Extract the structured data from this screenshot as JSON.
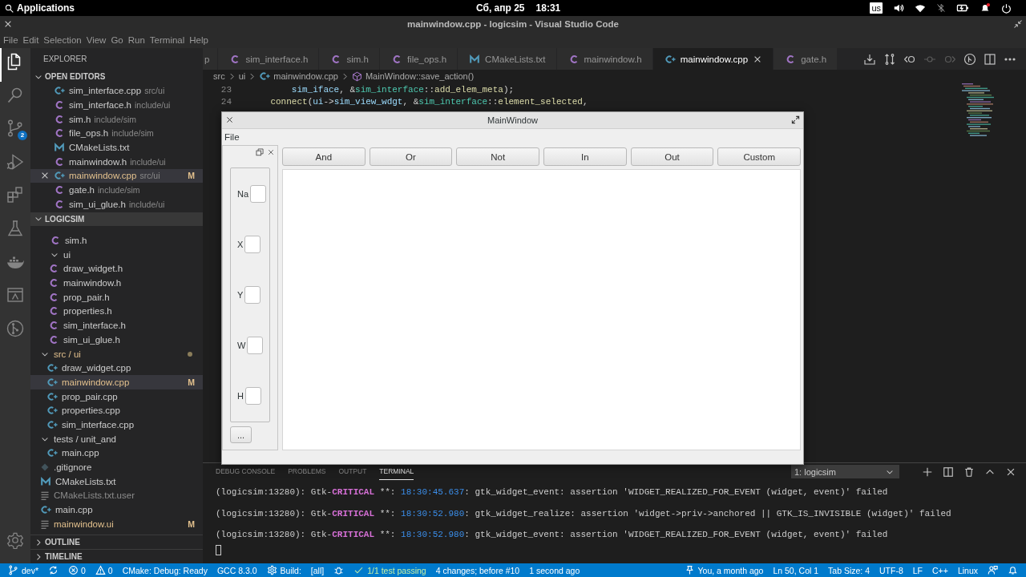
{
  "top_bar": {
    "apps_label": "Applications",
    "date": "Сб, апр 25",
    "time": "18:31",
    "keyboard_layout": "us"
  },
  "window": {
    "title": "mainwindow.cpp - logicsim - Visual Studio Code"
  },
  "menu": [
    "File",
    "Edit",
    "Selection",
    "View",
    "Go",
    "Run",
    "Terminal",
    "Help"
  ],
  "activity_bar": [
    {
      "kind": "explorer",
      "selected": true
    },
    {
      "kind": "search",
      "selected": false
    },
    {
      "kind": "scm",
      "selected": false,
      "badge": "2"
    },
    {
      "kind": "debug",
      "selected": false
    },
    {
      "kind": "extensions",
      "selected": false
    },
    {
      "kind": "testing",
      "selected": false
    },
    {
      "kind": "docker",
      "selected": false
    },
    {
      "kind": "remote",
      "selected": false
    },
    {
      "kind": "git_graph",
      "selected": false
    }
  ],
  "sidebar": {
    "title": "EXPLORER",
    "open_editors": {
      "title": "OPEN EDITORS",
      "expanded": true,
      "items": [
        {
          "name": "sim_interface.cpp",
          "path": "src/ui",
          "kind": "cpp",
          "selected": false,
          "modified": false
        },
        {
          "name": "sim_interface.h",
          "path": "include/ui",
          "kind": "c",
          "selected": false,
          "modified": false
        },
        {
          "name": "sim.h",
          "path": "include/sim",
          "kind": "c",
          "selected": false,
          "modified": false
        },
        {
          "name": "file_ops.h",
          "path": "include/sim",
          "kind": "c",
          "selected": false,
          "modified": false
        },
        {
          "name": "CMakeLists.txt",
          "kind": "cmake",
          "selected": false,
          "modified": false
        },
        {
          "name": "mainwindow.h",
          "path": "include/ui",
          "kind": "c",
          "selected": false,
          "modified": false
        },
        {
          "name": "mainwindow.cpp",
          "path": "src/ui",
          "kind": "cpp",
          "selected": true,
          "modified": true,
          "status": "M"
        },
        {
          "name": "gate.h",
          "path": "include/sim",
          "kind": "c",
          "selected": false,
          "modified": false
        },
        {
          "name": "sim_ui_glue.h",
          "path": "include/ui",
          "kind": "c",
          "selected": false,
          "modified": false
        }
      ]
    },
    "project": {
      "title": "LOGICSIM",
      "expanded": true,
      "scrolled_group": [
        {
          "name": "sim.h",
          "kind": "c",
          "selected": false,
          "modified": false,
          "ignored": false
        },
        {
          "name": "ui",
          "kind": "folder",
          "expanded": true,
          "selected": false,
          "modified": false,
          "ignored": false,
          "children": [
            {
              "name": "draw_widget.h",
              "kind": "c",
              "selected": false,
              "modified": false,
              "ignored": false
            },
            {
              "name": "mainwindow.h",
              "kind": "c",
              "selected": false,
              "modified": false,
              "ignored": false
            },
            {
              "name": "prop_pair.h",
              "kind": "c",
              "selected": false,
              "modified": false,
              "ignored": false
            },
            {
              "name": "properties.h",
              "kind": "c",
              "selected": false,
              "modified": false,
              "ignored": false
            },
            {
              "name": "sim_interface.h",
              "kind": "c",
              "selected": false,
              "modified": false,
              "ignored": false
            },
            {
              "name": "sim_ui_glue.h",
              "kind": "c",
              "selected": false,
              "modified": false,
              "ignored": false
            }
          ]
        }
      ],
      "items": [
        {
          "name": "src / ui",
          "kind": "folder",
          "expanded": true,
          "selected": false,
          "modified": true,
          "ignored": false,
          "children": [
            {
              "name": "draw_widget.cpp",
              "kind": "cpp",
              "selected": false,
              "modified": false,
              "ignored": false
            },
            {
              "name": "mainwindow.cpp",
              "kind": "cpp",
              "selected": true,
              "modified": true,
              "ignored": false,
              "status": "M"
            },
            {
              "name": "prop_pair.cpp",
              "kind": "cpp",
              "selected": false,
              "modified": false,
              "ignored": false
            },
            {
              "name": "properties.cpp",
              "kind": "cpp",
              "selected": false,
              "modified": false,
              "ignored": false
            },
            {
              "name": "sim_interface.cpp",
              "kind": "cpp",
              "selected": false,
              "modified": false,
              "ignored": false
            }
          ]
        },
        {
          "name": "tests / unit_and",
          "kind": "folder",
          "expanded": true,
          "selected": false,
          "modified": false,
          "ignored": false,
          "children": [
            {
              "name": "main.cpp",
              "kind": "cpp",
              "selected": false,
              "modified": false,
              "ignored": false
            }
          ]
        },
        {
          "name": ".gitignore",
          "kind": "git",
          "selected": false,
          "modified": false,
          "ignored": false
        },
        {
          "name": "CMakeLists.txt",
          "kind": "cmake",
          "selected": false,
          "modified": false,
          "ignored": false
        },
        {
          "name": "CMakeLists.txt.user",
          "kind": "text",
          "selected": false,
          "modified": false,
          "ignored": true
        },
        {
          "name": "main.cpp",
          "kind": "cpp",
          "selected": false,
          "modified": false,
          "ignored": false
        },
        {
          "name": "mainwindow.ui",
          "kind": "text",
          "selected": false,
          "modified": true,
          "ignored": false,
          "status": "M"
        }
      ]
    },
    "outline": {
      "title": "OUTLINE",
      "expanded": false
    },
    "timeline": {
      "title": "TIMELINE",
      "expanded": false
    }
  },
  "editor": {
    "tabs": [
      {
        "label": "p",
        "selected": false
      },
      {
        "label": "sim_interface.h",
        "kind": "c",
        "selected": false
      },
      {
        "label": "sim.h",
        "kind": "c",
        "selected": false
      },
      {
        "label": "file_ops.h",
        "kind": "c",
        "selected": false
      },
      {
        "label": "CMakeLists.txt",
        "kind": "cmake",
        "selected": false
      },
      {
        "label": "mainwindow.h",
        "kind": "c",
        "selected": false
      },
      {
        "label": "mainwindow.cpp",
        "kind": "cpp",
        "selected": true
      },
      {
        "label": "gate.h",
        "kind": "c",
        "selected": false
      }
    ],
    "toolbar": [
      {
        "kind": "download",
        "disabled": false
      },
      {
        "kind": "swap",
        "disabled": false
      },
      {
        "kind": "back",
        "disabled": false
      },
      {
        "kind": "commit",
        "disabled": true
      },
      {
        "kind": "forward",
        "disabled": true
      },
      {
        "kind": "graph",
        "disabled": false
      },
      {
        "kind": "split",
        "disabled": false
      },
      {
        "kind": "more",
        "disabled": false
      }
    ],
    "breadcrumb": [
      {
        "label": "src",
        "kind": "folder"
      },
      {
        "label": "ui",
        "kind": "folder"
      },
      {
        "label": "mainwindow.cpp",
        "kind": "cpp"
      },
      {
        "label": "MainWindow::save_action()",
        "kind": "method"
      }
    ],
    "code": [
      {
        "number": "23",
        "tokens": [
          {
            "kind": "var",
            "text": "        sim_iface"
          },
          {
            "kind": "plain",
            "text": ", &"
          },
          {
            "kind": "type",
            "text": "sim_interface"
          },
          {
            "kind": "plain",
            "text": "::"
          },
          {
            "kind": "fn",
            "text": "add_elem_meta"
          },
          {
            "kind": "plain",
            "text": ");"
          }
        ]
      },
      {
        "number": "24",
        "tokens": [
          {
            "kind": "fn",
            "text": "    connect"
          },
          {
            "kind": "plain",
            "text": "("
          },
          {
            "kind": "var",
            "text": "ui"
          },
          {
            "kind": "plain",
            "text": "->"
          },
          {
            "kind": "var",
            "text": "sim_view_wdgt"
          },
          {
            "kind": "plain",
            "text": ", &"
          },
          {
            "kind": "type",
            "text": "sim_interface"
          },
          {
            "kind": "plain",
            "text": "::"
          },
          {
            "kind": "fn",
            "text": "element_selected"
          },
          {
            "kind": "plain",
            "text": ","
          }
        ]
      }
    ]
  },
  "qt_window": {
    "title": "MainWindow",
    "menu": [
      "File"
    ],
    "dock": {
      "fields": [
        {
          "label": "Na"
        },
        {
          "label": "X"
        },
        {
          "label": "Y"
        },
        {
          "label": "W"
        },
        {
          "label": "H"
        }
      ],
      "more_button": "..."
    },
    "buttons": [
      "And",
      "Or",
      "Not",
      "In",
      "Out",
      "Custom"
    ]
  },
  "panel": {
    "tabs": [
      {
        "label": "DEBUG CONSOLE",
        "selected": false
      },
      {
        "label": "PROBLEMS",
        "selected": false
      },
      {
        "label": "OUTPUT",
        "selected": false
      },
      {
        "label": "TERMINAL",
        "selected": true
      }
    ],
    "terminal_select": "1: logicsim",
    "lines": [
      [
        {
          "kind": "plain",
          "text": "(logicsim:13280): Gtk-"
        },
        {
          "kind": "critical",
          "text": "CRITICAL"
        },
        {
          "kind": "plain",
          "text": " **: "
        },
        {
          "kind": "time",
          "text": "18:30:45.637"
        },
        {
          "kind": "plain",
          "text": ": gtk_widget_event: assertion 'WIDGET_REALIZED_FOR_EVENT (widget, event)' failed"
        }
      ],
      [
        {
          "kind": "plain",
          "text": "(logicsim:13280): Gtk-"
        },
        {
          "kind": "critical",
          "text": "CRITICAL"
        },
        {
          "kind": "plain",
          "text": " **: "
        },
        {
          "kind": "time",
          "text": "18:30:52.980"
        },
        {
          "kind": "plain",
          "text": ": gtk_widget_realize: assertion 'widget->priv->anchored || GTK_IS_INVISIBLE (widget)' failed"
        }
      ],
      [
        {
          "kind": "plain",
          "text": "(logicsim:13280): Gtk-"
        },
        {
          "kind": "critical",
          "text": "CRITICAL"
        },
        {
          "kind": "plain",
          "text": " **: "
        },
        {
          "kind": "time",
          "text": "18:30:52.980"
        },
        {
          "kind": "plain",
          "text": ": gtk_widget_event: assertion 'WIDGET_REALIZED_FOR_EVENT (widget, event)' failed"
        }
      ]
    ]
  },
  "status_bar": {
    "left": [
      {
        "kind": "branch",
        "text": "dev*"
      },
      {
        "kind": "sync"
      },
      {
        "kind": "errors",
        "text": "0"
      },
      {
        "kind": "warnings",
        "text": "0"
      },
      {
        "kind": "text",
        "text": "CMake: Debug: Ready"
      },
      {
        "kind": "text",
        "text": "GCC 8.3.0"
      },
      {
        "kind": "build",
        "text": "Build:"
      },
      {
        "kind": "text",
        "text": "[all]"
      },
      {
        "kind": "debug"
      },
      {
        "kind": "tests",
        "text": "1/1 test passing"
      },
      {
        "kind": "text",
        "text": "4 changes; before #10"
      },
      {
        "kind": "text",
        "text": "1 second ago"
      }
    ],
    "right": [
      {
        "kind": "blame",
        "text": "You, a month ago"
      },
      {
        "kind": "text",
        "text": "Ln 50, Col 1"
      },
      {
        "kind": "text",
        "text": "Tab Size: 4"
      },
      {
        "kind": "text",
        "text": "UTF-8"
      },
      {
        "kind": "text",
        "text": "LF"
      },
      {
        "kind": "text",
        "text": "C++"
      },
      {
        "kind": "text",
        "text": "Linux"
      },
      {
        "kind": "feedback"
      },
      {
        "kind": "bell"
      }
    ]
  }
}
